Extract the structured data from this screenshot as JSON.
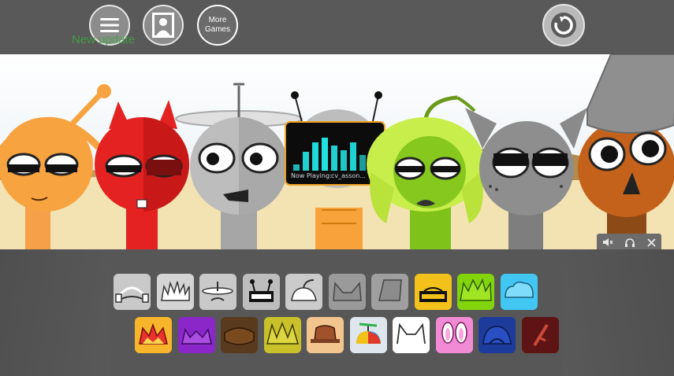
{
  "header": {
    "more_games_line1": "More",
    "more_games_line2": "Games",
    "update_text": "New update"
  },
  "now_playing": {
    "label": "Now Playing:",
    "track": "cv_asson..."
  },
  "icons": {
    "menu": "hamburger-menu-icon",
    "avatar": "portrait-icon",
    "reset": "reset-icon",
    "mute": "mute-icon",
    "headphones": "headphones-icon",
    "close": "close-icon"
  },
  "palette": {
    "bg_gray": "#575757",
    "sky": "#ffffff",
    "sand": "#f4e4b4",
    "update_green": "#3ea83e"
  },
  "tray": {
    "row1": [
      {
        "name": "gray-headphones-sound",
        "color": "#c9c9c9"
      },
      {
        "name": "gray-spiky-sound",
        "color": "#d4d4d4"
      },
      {
        "name": "gray-halo-sound",
        "color": "#c9c9c9"
      },
      {
        "name": "gray-antenna-sound",
        "color": "#bdbdbd"
      },
      {
        "name": "gray-sprout-sound",
        "color": "#cbcbcb"
      },
      {
        "name": "gray-cat-ears-sound",
        "color": "#9a9a9a"
      },
      {
        "name": "gray-bucket-sound",
        "color": "#9f9f9f"
      },
      {
        "name": "yellow-sound",
        "color": "#f3c21a"
      },
      {
        "name": "lime-sound",
        "color": "#82d40b"
      },
      {
        "name": "sky-blue-sound",
        "color": "#42c6f2"
      }
    ],
    "row2": [
      {
        "name": "orange-crown-sound",
        "color": "#f7b52c"
      },
      {
        "name": "purple-horns-sound",
        "color": "#8b27c9"
      },
      {
        "name": "brown-hair-sound",
        "color": "#5a3a1d"
      },
      {
        "name": "olive-spiky-sound",
        "color": "#c9c12a"
      },
      {
        "name": "tan-hat-sound",
        "color": "#f2c58f"
      },
      {
        "name": "propeller-hat-sound",
        "color": "#dfe6ee"
      },
      {
        "name": "white-cat-sound",
        "color": "#ffffff"
      },
      {
        "name": "pink-bunny-sound",
        "color": "#f28bd6"
      },
      {
        "name": "navy-hood-sound",
        "color": "#1d3b9b"
      },
      {
        "name": "maroon-stick-sound",
        "color": "#5e1414"
      }
    ]
  }
}
